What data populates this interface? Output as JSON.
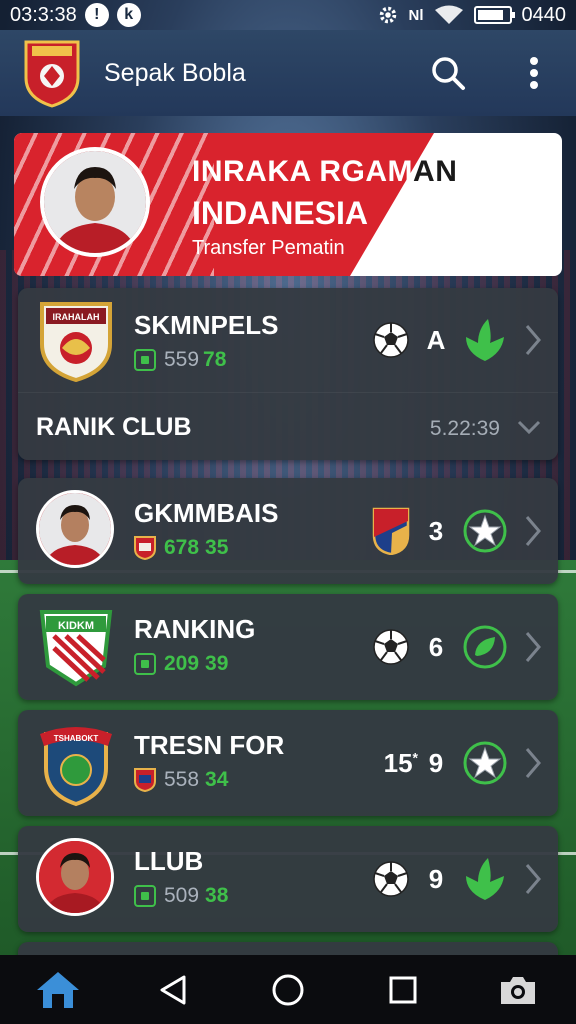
{
  "status_bar": {
    "time": "03:3:38",
    "signal_text": "Nl",
    "clock_right": "0440"
  },
  "app_bar": {
    "title": "Sepak Bobla",
    "search_icon": "search-icon",
    "menu_icon": "more-vert-icon"
  },
  "banner": {
    "title_line1_part1": "INRAKA RGAM",
    "title_line1_part2": "AN",
    "title_line2": "INDANESIA",
    "subtitle": "Transfer Pematin"
  },
  "featured": {
    "name": "SKMNPELS",
    "stat_a": "559",
    "stat_b": "78",
    "score": "A",
    "crest_text": "IRAHALAH",
    "club_name": "RANIK CLUB",
    "club_time": "5.22:39"
  },
  "rows": [
    {
      "name": "GKMMBAIS",
      "stat_a": "678",
      "stat_b": "35",
      "score": "3",
      "kind": "avatar"
    },
    {
      "name": "RANKING",
      "stat_a": "209",
      "stat_b": "39",
      "score": "6",
      "kind": "crest",
      "crest_text": "KIDKM"
    },
    {
      "name": "TRESN FOR",
      "stat_a": "558",
      "stat_b": "34",
      "pre_score": "15",
      "pre_mark": "*",
      "score": "9",
      "kind": "crest",
      "crest_text": "TSHABOKT"
    },
    {
      "name": "LLUB",
      "stat_a": "509",
      "stat_b": "38",
      "score": "9",
      "kind": "avatar"
    }
  ],
  "nav": [
    "home-icon",
    "back-icon",
    "home-circle-icon",
    "recents-icon",
    "camera-icon"
  ],
  "colors": {
    "accent_green": "#3fc04a",
    "banner_red": "#d9232d",
    "card_bg": "#343a42",
    "app_bar": "#23385a"
  }
}
